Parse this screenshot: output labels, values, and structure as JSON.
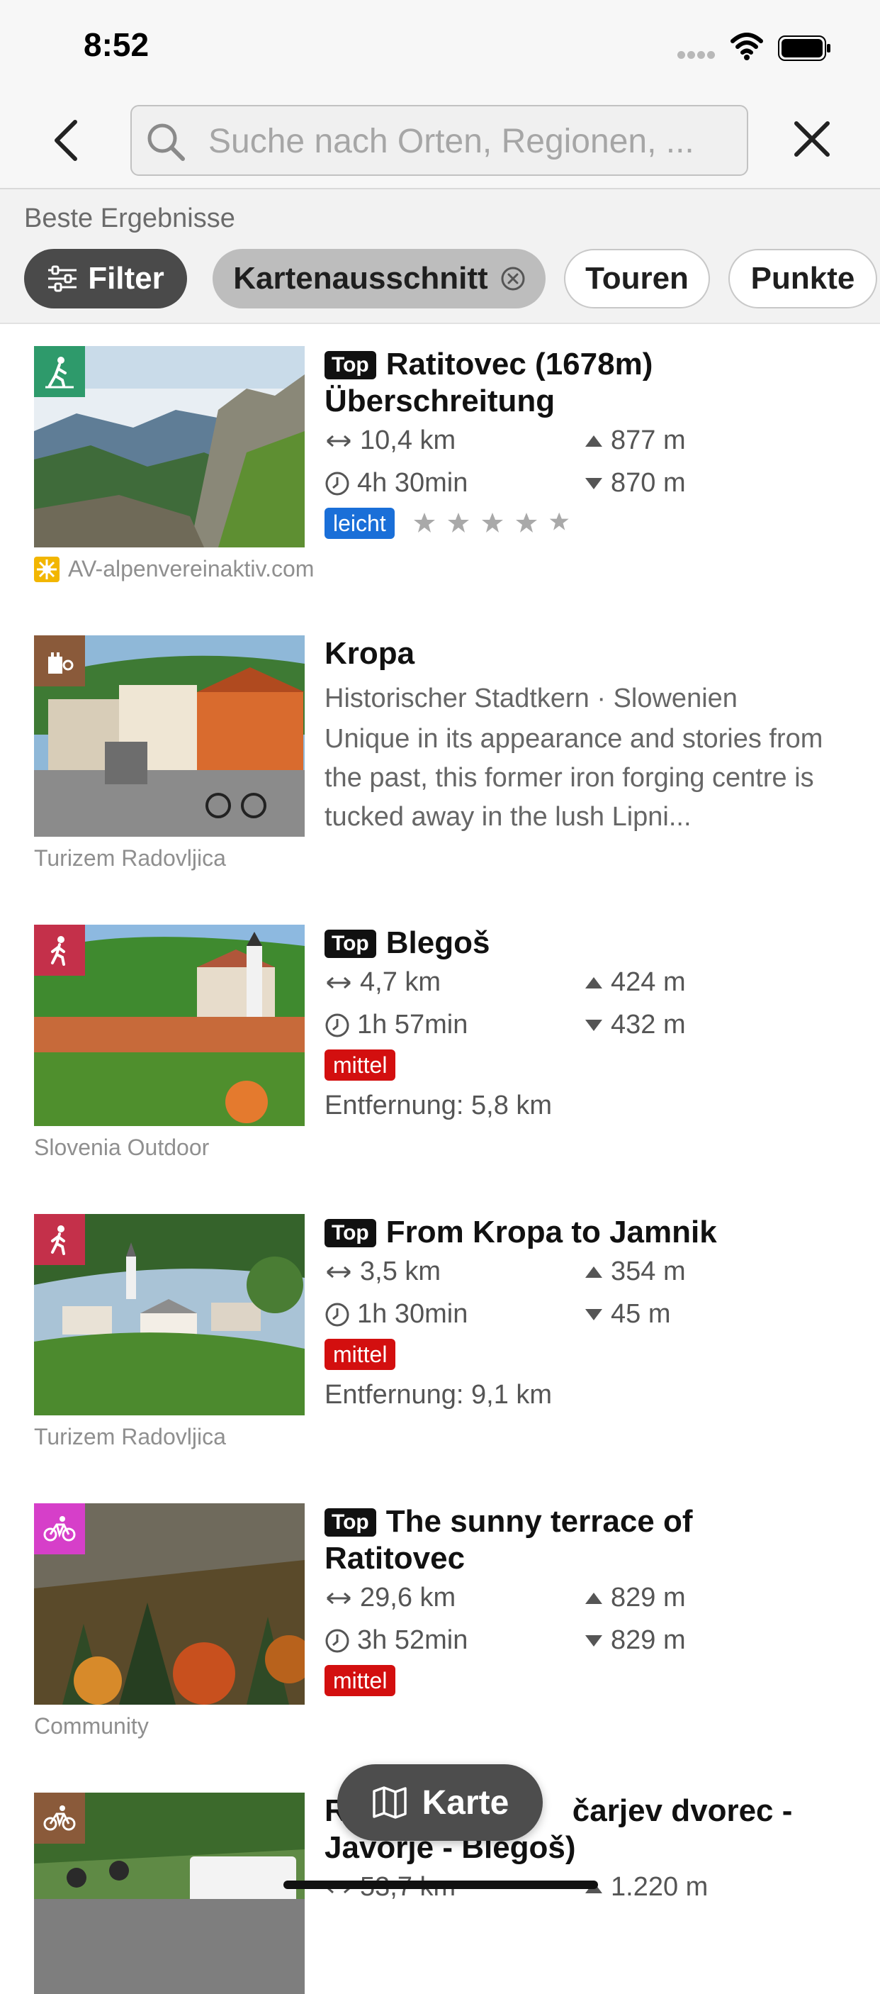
{
  "status_bar": {
    "time": "8:52"
  },
  "search": {
    "placeholder": "Suche nach Orten, Regionen, ..."
  },
  "section_label": "Beste Ergebnisse",
  "chips": {
    "filter": "Filter",
    "map_section": "Kartenausschnitt",
    "tours": "Touren",
    "points": "Punkte"
  },
  "colors": {
    "difficulty_easy": "#1a6fd8",
    "difficulty_medium": "#d30f0f",
    "hiking_badge": "#2e9a6b",
    "walk_badge": "#c4304a",
    "bike_badge": "#d63fc9",
    "poi_badge": "#8a5a3a"
  },
  "results": [
    {
      "top_tag": "Top",
      "title": "Ratitovec (1678m) Überschreitung",
      "distance": "10,4 km",
      "duration": "4h 30min",
      "ascent": "877 m",
      "descent": "870 m",
      "difficulty": "leicht",
      "rating": 0,
      "source": "AV-alpenvereinaktiv.com",
      "badge_icon": "hiking-icon"
    },
    {
      "title": "Kropa",
      "subtitle": "Historischer Stadtkern · Slowenien",
      "description": "Unique in its appearance and stories from the past, this former iron forging centre is tucked away in the lush Lipni...",
      "source": "Turizem Radovljica",
      "badge_icon": "castle-icon"
    },
    {
      "top_tag": "Top",
      "title": "Blegoš",
      "distance": "4,7 km",
      "duration": "1h 57min",
      "ascent": "424 m",
      "descent": "432 m",
      "difficulty": "mittel",
      "distance_away": "Entfernung: 5,8 km",
      "source": "Slovenia Outdoor",
      "badge_icon": "walking-icon"
    },
    {
      "top_tag": "Top",
      "title": "From Kropa to Jamnik",
      "distance": "3,5 km",
      "duration": "1h 30min",
      "ascent": "354 m",
      "descent": "45 m",
      "difficulty": "mittel",
      "distance_away": "Entfernung: 9,1 km",
      "source": "Turizem Radovljica",
      "badge_icon": "walking-icon"
    },
    {
      "top_tag": "Top",
      "title": "The sunny terrace of Ratitovec",
      "distance": "29,6 km",
      "duration": "3h 52min",
      "ascent": "829 m",
      "descent": "829 m",
      "difficulty": "mittel",
      "source": "Community",
      "badge_icon": "bike-icon"
    },
    {
      "title_visible_start": "R",
      "title_visible_end": "čarjev dvorec -",
      "title_line2": "Javorje - Blegoš)",
      "distance": "53,7 km",
      "ascent": "1.220 m",
      "badge_icon": "ebike-icon"
    }
  ],
  "map_button": {
    "label": "Karte"
  }
}
